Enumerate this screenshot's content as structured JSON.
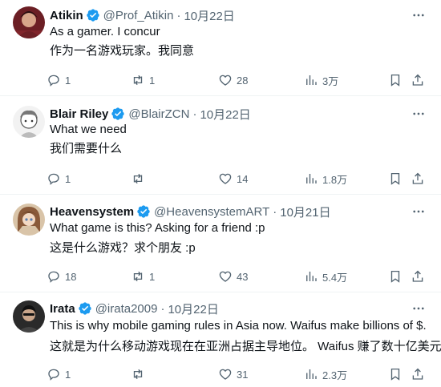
{
  "colors": {
    "text": "#0f1419",
    "secondary": "#536471",
    "verified_blue": "#1d9bf0",
    "divider": "#eff3f4"
  },
  "icons": {
    "verified": "verified-badge-icon",
    "more": "more-horizontal-icon",
    "reply": "reply-icon",
    "repost": "repost-icon",
    "like": "heart-icon",
    "views": "views-chart-icon",
    "bookmark": "bookmark-icon",
    "share": "share-icon"
  },
  "tweets": [
    {
      "name": "Atikin",
      "handle": "@Prof_Atikin",
      "separator": "·",
      "date": "10月22日",
      "text1": "As a gamer. I concur",
      "text2": "作为一名游戏玩家。我同意",
      "replies": "1",
      "reposts": "1",
      "likes": "28",
      "views": "3万"
    },
    {
      "name": "Blair Riley",
      "handle": "@BlairZCN",
      "separator": "·",
      "date": "10月22日",
      "text1": "What we need",
      "text2": "我们需要什么",
      "replies": "1",
      "reposts": "",
      "likes": "14",
      "views": "1.8万"
    },
    {
      "name": "Heavensystem",
      "handle": "@HeavensystemART",
      "separator": "·",
      "date": "10月21日",
      "text1": "What game is this? Asking for a friend :p",
      "text2": "这是什么游戏？求个朋友 :p",
      "replies": "18",
      "reposts": "1",
      "likes": "43",
      "views": "5.4万"
    },
    {
      "name": "Irata",
      "handle": "@irata2009",
      "separator": "·",
      "date": "10月22日",
      "text1": "This is why mobile gaming rules in Asia now.  Waifus make billions of $.",
      "text2": "这就是为什么移动游戏现在在亚洲占据主导地位。 Waifus 赚了数十亿美元。",
      "replies": "1",
      "reposts": "",
      "likes": "31",
      "views": "2.3万"
    }
  ]
}
